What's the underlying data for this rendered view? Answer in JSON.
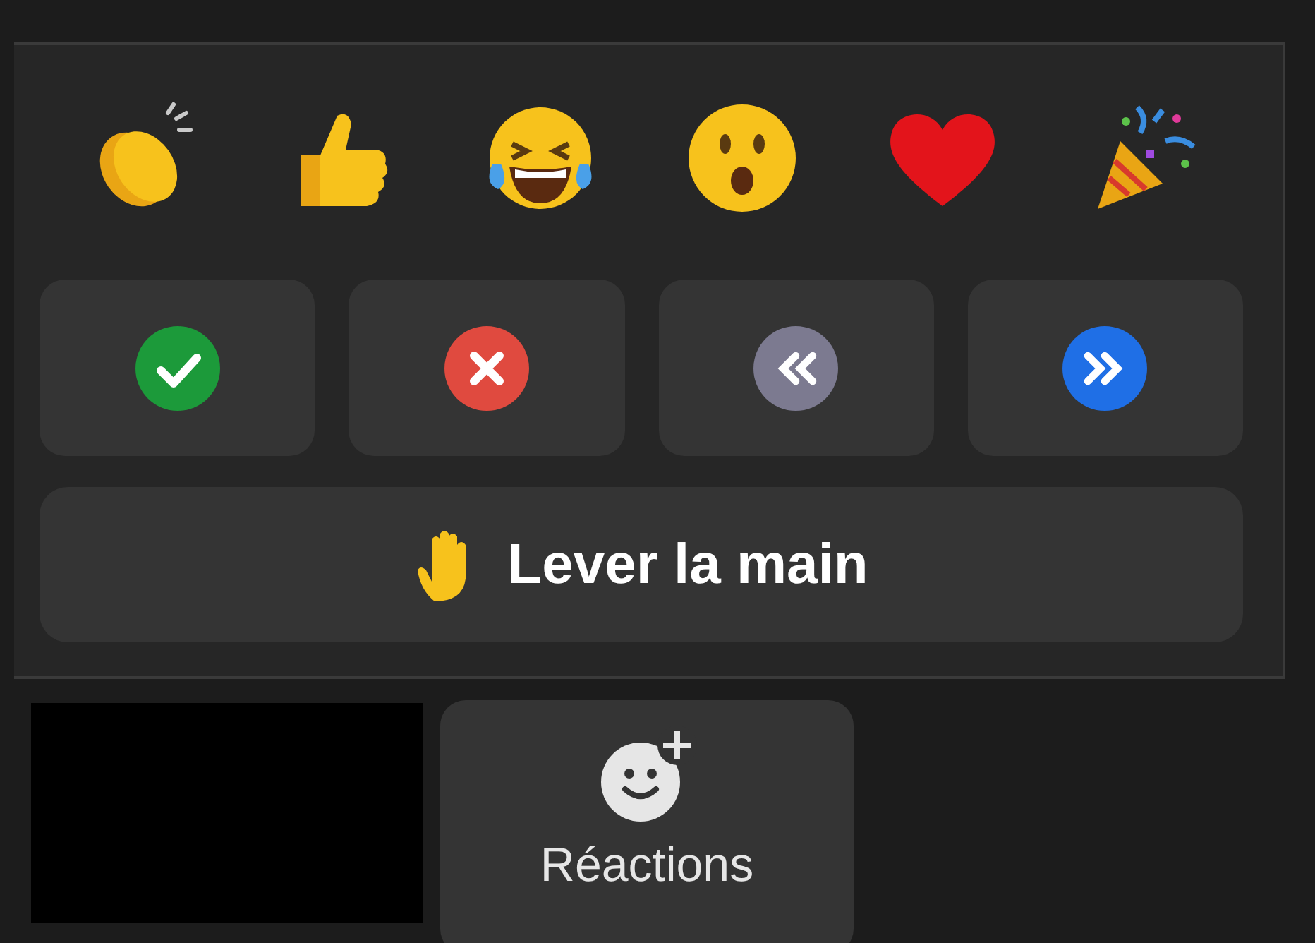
{
  "reactions": [
    {
      "kind": "clap"
    },
    {
      "kind": "thumbs_up"
    },
    {
      "kind": "laugh"
    },
    {
      "kind": "surprised"
    },
    {
      "kind": "heart"
    },
    {
      "kind": "party"
    }
  ],
  "feedback_buttons": [
    {
      "kind": "yes"
    },
    {
      "kind": "no"
    },
    {
      "kind": "slower"
    },
    {
      "kind": "faster"
    }
  ],
  "raise_hand_button": {
    "label": "Lever la main"
  },
  "toolbar": {
    "reactions_button": {
      "label": "Réactions"
    }
  }
}
